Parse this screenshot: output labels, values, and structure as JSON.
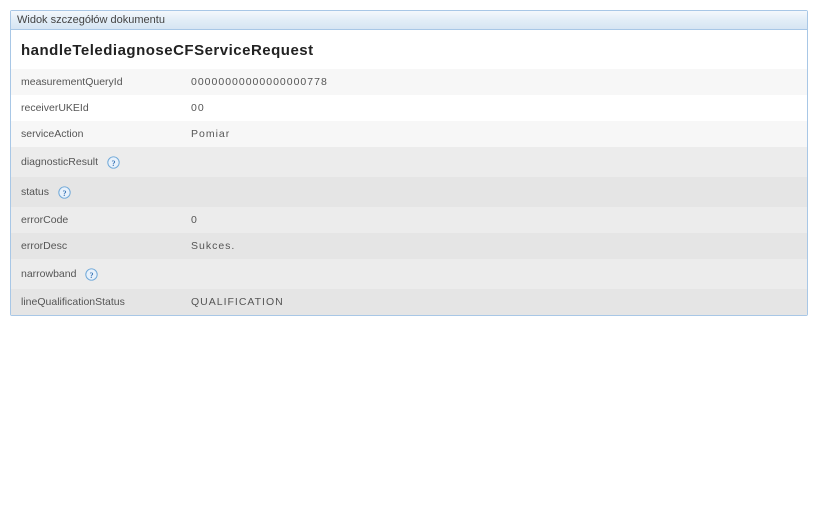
{
  "panel": {
    "title": "Widok szczegółów dokumentu"
  },
  "document": {
    "name": "handleTelediagnoseCFServiceRequest"
  },
  "fields": {
    "measurementQueryId": {
      "label": "measurementQueryId",
      "value": "00000000000000000778"
    },
    "receiverUKEId": {
      "label": "receiverUKEId",
      "value": "00"
    },
    "serviceAction": {
      "label": "serviceAction",
      "value": "Pomiar"
    }
  },
  "sections": {
    "diagnosticResult": {
      "label": "diagnosticResult"
    },
    "status": {
      "label": "status"
    },
    "narrowband": {
      "label": "narrowband"
    }
  },
  "statusFields": {
    "errorCode": {
      "label": "errorCode",
      "value": "0"
    },
    "errorDesc": {
      "label": "errorDesc",
      "value": "Sukces."
    }
  },
  "narrowbandFields": {
    "lineQualificationStatus": {
      "label": "lineQualificationStatus",
      "value": "QUALIFICATION"
    }
  }
}
